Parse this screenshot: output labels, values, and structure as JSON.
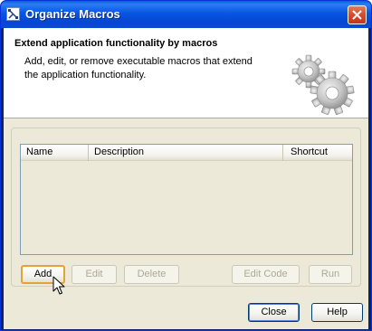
{
  "window": {
    "title": "Organize Macros",
    "icon": "diagram-icon",
    "close_icon": "close-icon"
  },
  "header": {
    "title": "Extend application functionality by macros",
    "description": "Add, edit, or remove executable macros that extend the application functionality.",
    "image": "gears-icon"
  },
  "table": {
    "columns": [
      "Name",
      "Description",
      "Shortcut"
    ],
    "rows": []
  },
  "actions": {
    "add": "Add",
    "edit": "Edit",
    "delete": "Delete",
    "edit_code": "Edit Code",
    "run": "Run"
  },
  "footer": {
    "close": "Close",
    "help": "Help"
  },
  "colors": {
    "titlebar": "#0955e3",
    "dialog_bg": "#ece9d8",
    "focus_ring": "#e2a33a",
    "close_button": "#d74b2b"
  }
}
